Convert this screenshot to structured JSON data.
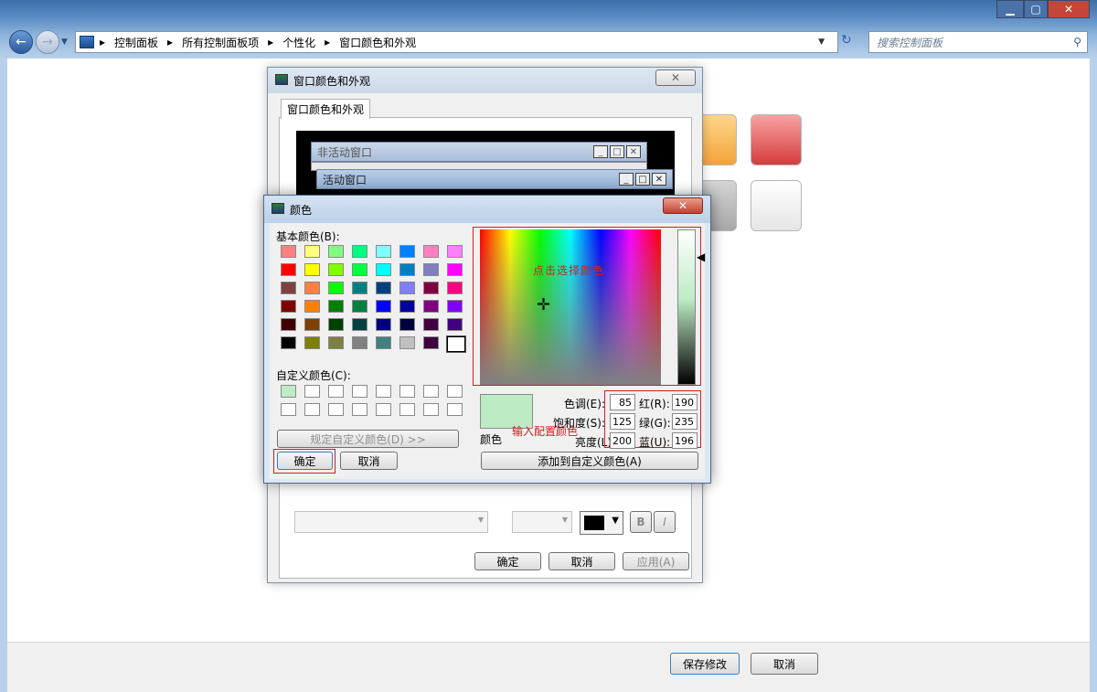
{
  "window": {
    "breadcrumb": [
      "控制面板",
      "所有控制面板项",
      "个性化",
      "窗口颜色和外观"
    ],
    "search_placeholder": "搜索控制面板",
    "save_label": "保存修改",
    "cancel_label": "取消"
  },
  "appearance_dialog": {
    "title": "窗口颜色和外观",
    "tab": "窗口颜色和外观",
    "inactive_window": "非活动窗口",
    "active_window": "活动窗口",
    "ok_label": "确定",
    "cancel_label": "取消",
    "apply_label": "应用(A)",
    "bold_label": "B",
    "italic_label": "I"
  },
  "color_dialog": {
    "title": "颜色",
    "basic_colors_label": "基本颜色(B):",
    "custom_colors_label": "自定义颜色(C):",
    "define_custom_label": "规定自定义颜色(D) >>",
    "ok_label": "确定",
    "cancel_label": "取消",
    "add_custom_label": "添加到自定义颜色(A)",
    "preview_label": "颜色",
    "annotation_pick": "点击选择颜色",
    "annotation_input": "输入配置颜色",
    "hue_label": "色调(E):",
    "sat_label": "饱和度(S):",
    "lum_label": "亮度(L):",
    "red_label": "红(R):",
    "green_label": "绿(G):",
    "blue_label": "蓝(U):",
    "hue": "85",
    "sat": "125",
    "lum": "200",
    "red": "190",
    "green": "235",
    "blue": "196",
    "preview_color": "#bdebc4",
    "basic_colors": [
      "#ff8080",
      "#ffff80",
      "#80ff80",
      "#00ff80",
      "#80ffff",
      "#0080ff",
      "#ff80c0",
      "#ff80ff",
      "#ff0000",
      "#ffff00",
      "#80ff00",
      "#00ff40",
      "#00ffff",
      "#0080c0",
      "#8080c0",
      "#ff00ff",
      "#804040",
      "#ff8040",
      "#00ff00",
      "#008080",
      "#004080",
      "#8080ff",
      "#800040",
      "#ff0080",
      "#800000",
      "#ff8000",
      "#008000",
      "#008040",
      "#0000ff",
      "#0000a0",
      "#800080",
      "#8000ff",
      "#400000",
      "#804000",
      "#004000",
      "#004040",
      "#000080",
      "#000040",
      "#400040",
      "#400080",
      "#000000",
      "#808000",
      "#808040",
      "#808080",
      "#408080",
      "#c0c0c0",
      "#400040",
      "#ffffff"
    ]
  }
}
